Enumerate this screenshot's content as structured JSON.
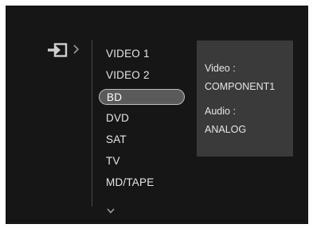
{
  "menu": {
    "items": [
      {
        "label": "VIDEO 1"
      },
      {
        "label": "VIDEO 2"
      },
      {
        "label": "BD"
      },
      {
        "label": "DVD"
      },
      {
        "label": "SAT"
      },
      {
        "label": "TV"
      },
      {
        "label": "MD/TAPE"
      }
    ],
    "selected_label": "BD"
  },
  "info": {
    "video_label": "Video :",
    "video_value": "COMPONENT1",
    "audio_label": "Audio :",
    "audio_value": "ANALOG"
  },
  "icons": {
    "input_icon": "input-source-icon",
    "breadcrumb_chevron": "chevron-right-icon",
    "scroll_indicator": "chevron-down-icon"
  },
  "colors": {
    "screen_background": "#161616",
    "panel_background": "#3a3a3a",
    "selected_background": "#5a5a5a",
    "text": "#e6e6e6"
  }
}
